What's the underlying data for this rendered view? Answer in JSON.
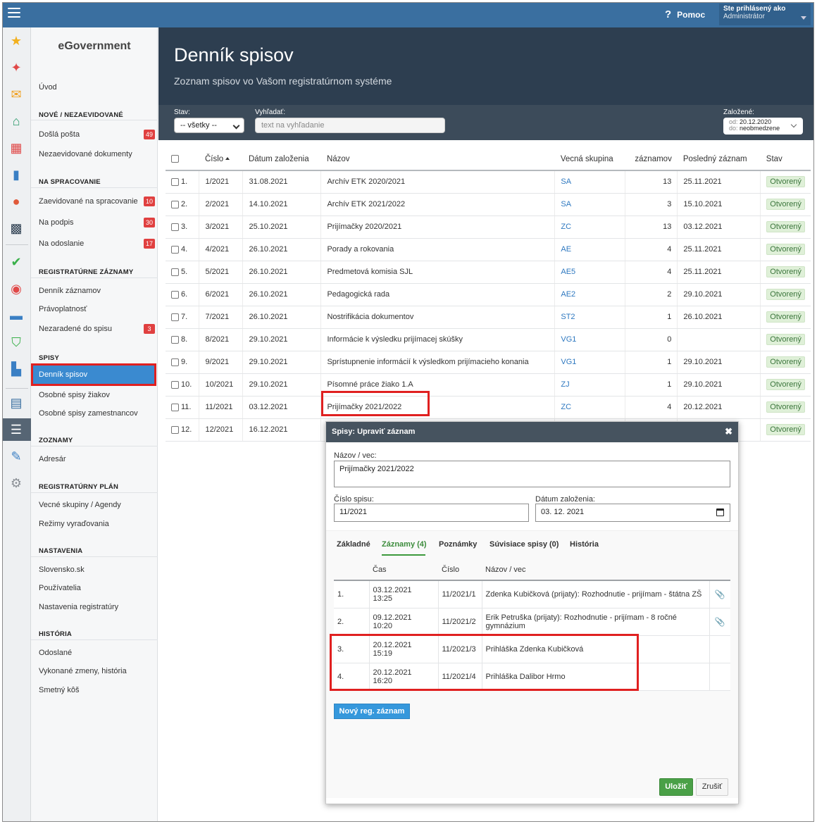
{
  "topbar": {
    "help_label": "Pomoc",
    "user_line1": "Ste prihlásený ako",
    "user_line2": "Administrátor"
  },
  "sidebar": {
    "brand": "eGovernment",
    "home": "Úvod",
    "sections": {
      "new": "NOVÉ / NEZAEVIDOVANÉ",
      "processing": "NA SPRACOVANIE",
      "records": "REGISTRATÚRNE ZÁZNAMY",
      "files": "SPISY",
      "lists": "ZOZNAMY",
      "plan": "REGISTRATÚRNY PLÁN",
      "settings": "NASTAVENIA",
      "history": "HISTÓRIA"
    },
    "items": {
      "incoming_mail": "Došlá pošta",
      "incoming_mail_count": "49",
      "unregistered_docs": "Nezaevidované dokumenty",
      "to_process": "Zaevidované na spracovanie",
      "to_process_count": "10",
      "to_sign": "Na podpis",
      "to_sign_count": "30",
      "to_send": "Na odoslanie",
      "to_send_count": "17",
      "records_journal": "Denník záznamov",
      "validity": "Právoplatnosť",
      "unassigned": "Nezaradené do spisu",
      "unassigned_count": "3",
      "files_journal": "Denník spisov",
      "student_files": "Osobné spisy žiakov",
      "employee_files": "Osobné spisy zamestnancov",
      "address_book": "Adresár",
      "subject_groups": "Vecné skupiny / Agendy",
      "disposal_modes": "Režimy vyraďovania",
      "slovensko": "Slovensko.sk",
      "users": "Používatelia",
      "registry_settings": "Nastavenia registratúry",
      "sent": "Odoslané",
      "changes_history": "Vykonané zmeny, história",
      "trash": "Smetný kôš"
    }
  },
  "header": {
    "title": "Denník spisov",
    "subtitle": "Zoznam spisov vo Vašom registratúrnom systéme"
  },
  "filters": {
    "stav_label": "Stav:",
    "stav_value": "-- všetky --",
    "search_label": "Vyhľadať:",
    "search_placeholder": "text na vyhľadanie",
    "created_label": "Založené:",
    "from_key": "od:",
    "from_value": "20.12.2020",
    "to_key": "do:",
    "to_value": "neobmedzene"
  },
  "table": {
    "headers": [
      "Číslo",
      "Dátum založenia",
      "Názov",
      "Vecná skupina",
      "záznamov",
      "Posledný záznam",
      "Stav"
    ],
    "rows": [
      {
        "idx": "1.",
        "cislo": "1/2021",
        "datum": "31.08.2021",
        "nazov": "Archív ETK 2020/2021",
        "skupina": "SA",
        "zaznamov": "13",
        "posledny": "25.11.2021",
        "stav": "Otvorený"
      },
      {
        "idx": "2.",
        "cislo": "2/2021",
        "datum": "14.10.2021",
        "nazov": "Archív ETK 2021/2022",
        "skupina": "SA",
        "zaznamov": "3",
        "posledny": "15.10.2021",
        "stav": "Otvorený"
      },
      {
        "idx": "3.",
        "cislo": "3/2021",
        "datum": "25.10.2021",
        "nazov": "Prijímačky 2020/2021",
        "skupina": "ZC",
        "zaznamov": "13",
        "posledny": "03.12.2021",
        "stav": "Otvorený"
      },
      {
        "idx": "4.",
        "cislo": "4/2021",
        "datum": "26.10.2021",
        "nazov": "Porady a rokovania",
        "skupina": "AE",
        "zaznamov": "4",
        "posledny": "25.11.2021",
        "stav": "Otvorený"
      },
      {
        "idx": "5.",
        "cislo": "5/2021",
        "datum": "26.10.2021",
        "nazov": "Predmetová komisia SJL",
        "skupina": "AE5",
        "zaznamov": "4",
        "posledny": "25.11.2021",
        "stav": "Otvorený"
      },
      {
        "idx": "6.",
        "cislo": "6/2021",
        "datum": "26.10.2021",
        "nazov": "Pedagogická rada",
        "skupina": "AE2",
        "zaznamov": "2",
        "posledny": "29.10.2021",
        "stav": "Otvorený"
      },
      {
        "idx": "7.",
        "cislo": "7/2021",
        "datum": "26.10.2021",
        "nazov": "Nostrifikácia dokumentov",
        "skupina": "ST2",
        "zaznamov": "1",
        "posledny": "26.10.2021",
        "stav": "Otvorený"
      },
      {
        "idx": "8.",
        "cislo": "8/2021",
        "datum": "29.10.2021",
        "nazov": "Informácie k výsledku prijímacej skúšky",
        "skupina": "VG1",
        "zaznamov": "0",
        "posledny": "",
        "stav": "Otvorený"
      },
      {
        "idx": "9.",
        "cislo": "9/2021",
        "datum": "29.10.2021",
        "nazov": "Sprístupnenie informácií k výsledkom prijímacieho konania",
        "skupina": "VG1",
        "zaznamov": "1",
        "posledny": "29.10.2021",
        "stav": "Otvorený"
      },
      {
        "idx": "10.",
        "cislo": "10/2021",
        "datum": "29.10.2021",
        "nazov": "Písomné práce žiako 1.A",
        "skupina": "ZJ",
        "zaznamov": "1",
        "posledny": "29.10.2021",
        "stav": "Otvorený"
      },
      {
        "idx": "11.",
        "cislo": "11/2021",
        "datum": "03.12.2021",
        "nazov": "Prijímačky 2021/2022",
        "skupina": "ZC",
        "zaznamov": "4",
        "posledny": "20.12.2021",
        "stav": "Otvorený"
      },
      {
        "idx": "12.",
        "cislo": "12/2021",
        "datum": "16.12.2021",
        "nazov": "",
        "skupina": "",
        "zaznamov": "",
        "posledny": "",
        "stav": "Otvorený"
      }
    ]
  },
  "modal": {
    "title": "Spisy: Upraviť záznam",
    "name_label": "Názov / vec:",
    "name_value": "Prijímačky 2021/2022",
    "number_label": "Číslo spisu:",
    "number_value": "11/2021",
    "date_label": "Dátum založenia:",
    "date_value": "03. 12. 2021",
    "tabs": [
      "Základné",
      "Záznamy (4)",
      "Poznámky",
      "Súvisiace spisy (0)",
      "História"
    ],
    "records_headers": [
      "Čas",
      "Číslo",
      "Názov / vec"
    ],
    "records": [
      {
        "idx": "1.",
        "date": "03.12.2021",
        "time": "13:25",
        "cislo": "11/2021/1",
        "nazov": "Zdenka Kubičková (prijaty): Rozhodnutie - prijímam - štátna ZŠ",
        "clip": "📎"
      },
      {
        "idx": "2.",
        "date": "09.12.2021",
        "time": "10:20",
        "cislo": "11/2021/2",
        "nazov": "Erik Petruška (prijaty): Rozhodnutie - prijímam - 8 ročné gymnázium",
        "clip": "📎"
      },
      {
        "idx": "3.",
        "date": "20.12.2021",
        "time": "15:19",
        "cislo": "11/2021/3",
        "nazov": "Prihláška Zdenka Kubičková",
        "clip": ""
      },
      {
        "idx": "4.",
        "date": "20.12.2021",
        "time": "16:20",
        "cislo": "11/2021/4",
        "nazov": "Prihláška Dalibor Hrmo",
        "clip": ""
      }
    ],
    "new_record_button": "Nový reg. záznam",
    "save_button": "Uložiť",
    "cancel_button": "Zrušiť",
    "close": "✖"
  },
  "colors": {
    "topbar": "#3a6fa0",
    "header": "#2d3e50",
    "accent": "#3598dc",
    "highlight": "#e02020",
    "save": "#4aa047"
  }
}
